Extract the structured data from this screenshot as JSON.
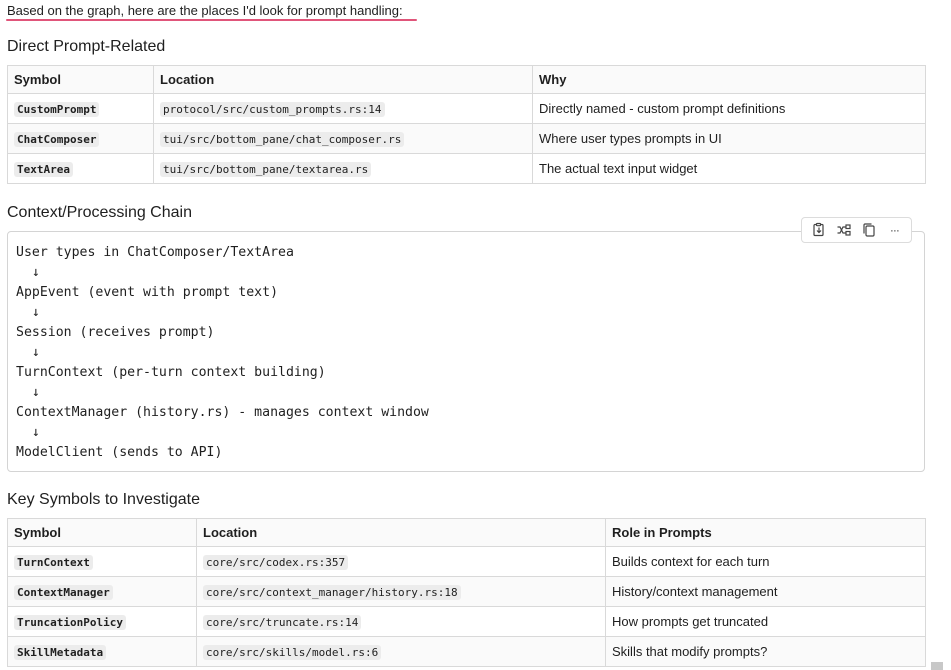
{
  "intro": "Based on the graph, here are the places I'd look for prompt handling:",
  "section1": {
    "heading": "Direct Prompt-Related",
    "columns": [
      "Symbol",
      "Location",
      "Why"
    ],
    "rows": [
      {
        "symbol": "CustomPrompt",
        "location": "protocol/src/custom_prompts.rs:14",
        "note": "Directly named - custom prompt definitions"
      },
      {
        "symbol": "ChatComposer",
        "location": "tui/src/bottom_pane/chat_composer.rs",
        "note": "Where user types prompts in UI"
      },
      {
        "symbol": "TextArea",
        "location": "tui/src/bottom_pane/textarea.rs",
        "note": "The actual text input widget"
      }
    ]
  },
  "section2": {
    "heading": "Context/Processing Chain",
    "code_lines": [
      "User types in ChatComposer/TextArea",
      "  ↓",
      "AppEvent (event with prompt text)",
      "  ↓",
      "Session (receives prompt)",
      "  ↓",
      "TurnContext (per-turn context building)",
      "  ↓",
      "ContextManager (history.rs) - manages context window",
      "  ↓",
      "ModelClient (sends to API)"
    ],
    "toolbar_icons": [
      "insert-into-file-icon",
      "apply-diff-icon",
      "copy-icon",
      "more-icon"
    ],
    "more_label": "···"
  },
  "section3": {
    "heading": "Key Symbols to Investigate",
    "columns": [
      "Symbol",
      "Location",
      "Role in Prompts"
    ],
    "rows": [
      {
        "symbol": "TurnContext",
        "location": "core/src/codex.rs:357",
        "note": "Builds context for each turn"
      },
      {
        "symbol": "ContextManager",
        "location": "core/src/context_manager/history.rs:18",
        "note": "History/context management"
      },
      {
        "symbol": "TruncationPolicy",
        "location": "core/src/truncate.rs:14",
        "note": "How prompts get truncated"
      },
      {
        "symbol": "SkillMetadata",
        "location": "core/src/skills/model.rs:6",
        "note": "Skills that modify prompts?"
      }
    ]
  },
  "colors": {
    "underline": "#e0557a",
    "border": "#d9d9d9",
    "code_bg": "#ececec"
  }
}
